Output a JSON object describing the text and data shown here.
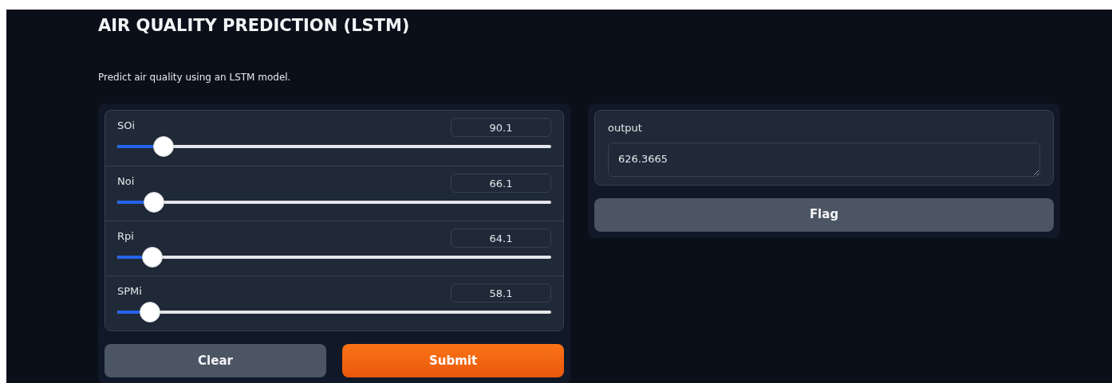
{
  "title": "AIR QUALITY PREDICTION (LSTM)",
  "description": "Predict air quality using an LSTM model.",
  "inputs": [
    {
      "label": "SOi",
      "value": "90.1",
      "level": 0.107
    },
    {
      "label": "Noi",
      "value": "66.1",
      "level": 0.085
    },
    {
      "label": "Rpi",
      "value": "64.1",
      "level": 0.081
    },
    {
      "label": "SPMi",
      "value": "58.1",
      "level": 0.076
    }
  ],
  "buttons": [
    {
      "label": "Clear",
      "kind": "secondary"
    },
    {
      "label": "Submit",
      "kind": "primary"
    }
  ],
  "output": {
    "label": "output",
    "value": "626.3665"
  },
  "flag_button": {
    "label": "Flag"
  }
}
